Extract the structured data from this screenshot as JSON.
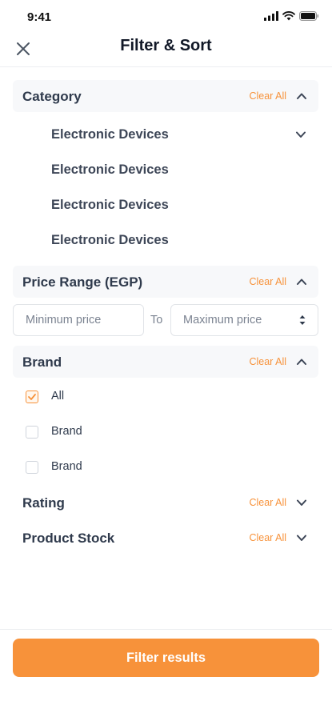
{
  "status_bar": {
    "time": "9:41"
  },
  "header": {
    "title": "Filter & Sort"
  },
  "sections": {
    "category": {
      "title": "Category",
      "clear_label": "Clear All",
      "items": [
        "Electronic Devices",
        "Electronic Devices",
        "Electronic Devices",
        "Electronic Devices"
      ]
    },
    "price": {
      "title": "Price Range (EGP)",
      "clear_label": "Clear All",
      "min_placeholder": "Minimum price",
      "max_placeholder": "Maximum price",
      "to_label": "To"
    },
    "brand": {
      "title": "Brand",
      "clear_label": "Clear All",
      "options": [
        {
          "label": "All",
          "checked": true
        },
        {
          "label": "Brand",
          "checked": false
        },
        {
          "label": "Brand",
          "checked": false
        }
      ]
    },
    "rating": {
      "title": "Rating",
      "clear_label": "Clear All"
    },
    "stock": {
      "title": "Product Stock",
      "clear_label": "Clear All"
    }
  },
  "footer": {
    "button_label": "Filter results"
  },
  "colors": {
    "accent": "#f7923a",
    "section_bg": "#f7f8fa",
    "text_dark": "#2f3a4c"
  }
}
